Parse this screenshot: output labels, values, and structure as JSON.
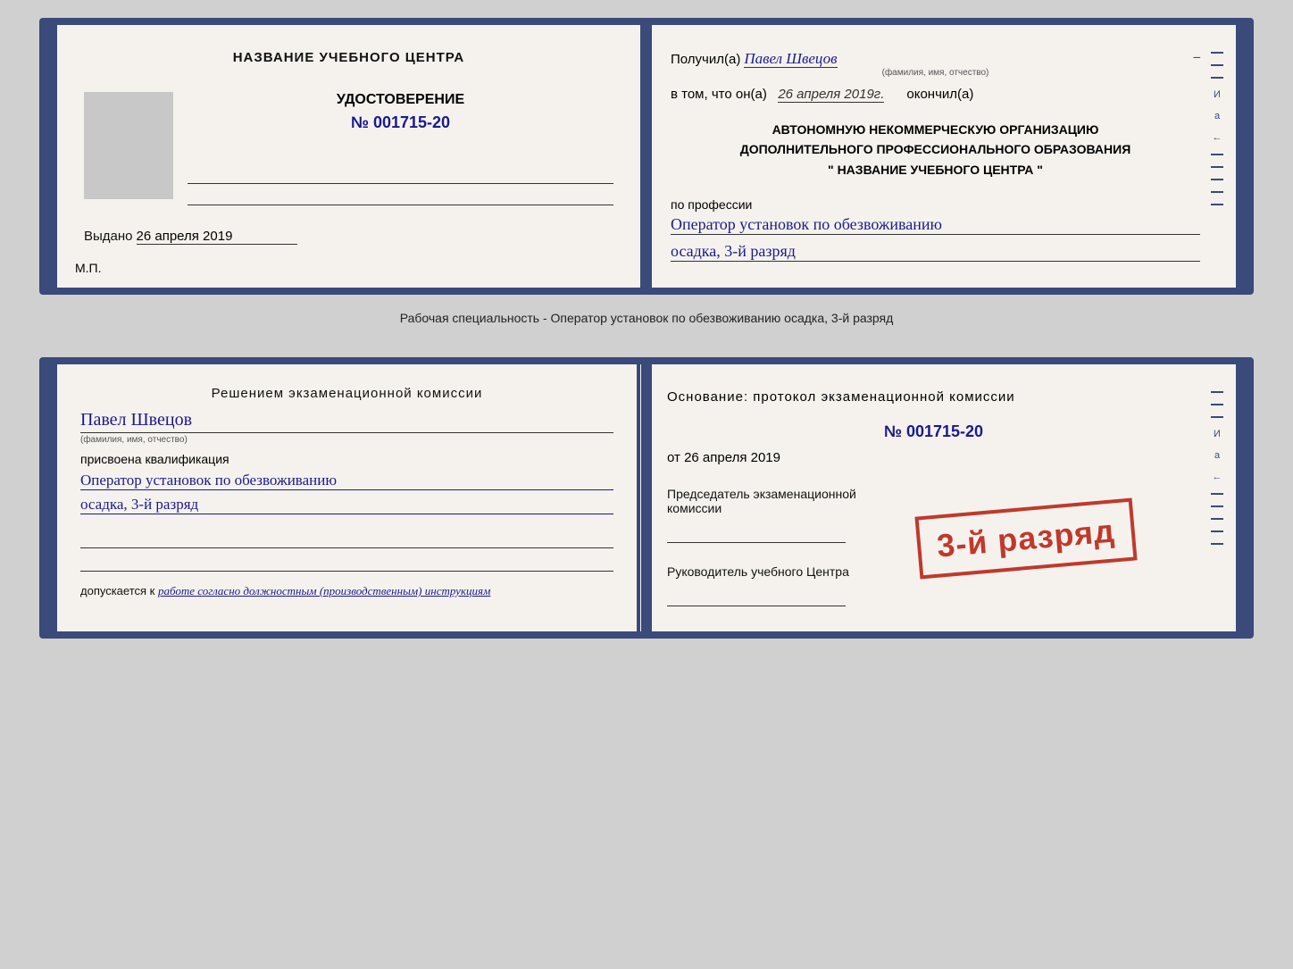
{
  "card1": {
    "left": {
      "center_name": "НАЗВАНИЕ УЧЕБНОГО ЦЕНТРА",
      "cert_type": "УДОСТОВЕРЕНИЕ",
      "cert_number": "№ 001715-20",
      "issued_label": "Выдано",
      "issued_date": "26 апреля 2019",
      "mp_label": "М.П."
    },
    "right": {
      "received_label": "Получил(а)",
      "person_name": "Павел Швецов",
      "fio_sub": "(фамилия, имя, отчество)",
      "tom_prefix": "в том, что он(а)",
      "tom_date": "26 апреля 2019г.",
      "tom_suffix": "окончил(а)",
      "org_line1": "АВТОНОМНУЮ НЕКОММЕРЧЕСКУЮ ОРГАНИЗАЦИЮ",
      "org_line2": "ДОПОЛНИТЕЛЬНОГО ПРОФЕССИОНАЛЬНОГО ОБРАЗОВАНИЯ",
      "org_line3": "\"    НАЗВАНИЕ УЧЕБНОГО ЦЕНТРА    \"",
      "profession_label": "по профессии",
      "profession_value": "Оператор установок по обезвоживанию",
      "rank_value": "осадка, 3-й разряд"
    }
  },
  "subtitle": "Рабочая специальность - Оператор установок по обезвоживанию осадка, 3-й разряд",
  "card2": {
    "left": {
      "decision_title": "Решением  экзаменационной  комиссии",
      "person_name": "Павел Швецов",
      "fio_sub": "(фамилия, имя, отчество)",
      "assigned_label": "присвоена квалификация",
      "qualification": "Оператор установок по обезвоживанию",
      "rank": "осадка, 3-й разряд",
      "admitted_label": "допускается к",
      "admitted_value": "работе согласно должностным (производственным) инструкциям"
    },
    "right": {
      "basis_title": "Основание: протокол экзаменационной  комиссии",
      "protocol_number": "№  001715-20",
      "from_prefix": "от",
      "from_date": "26 апреля 2019",
      "chairman_label": "Председатель экзаменационной комиссии",
      "head_label": "Руководитель учебного Центра"
    },
    "stamp": {
      "text": "3-й разряд"
    }
  }
}
